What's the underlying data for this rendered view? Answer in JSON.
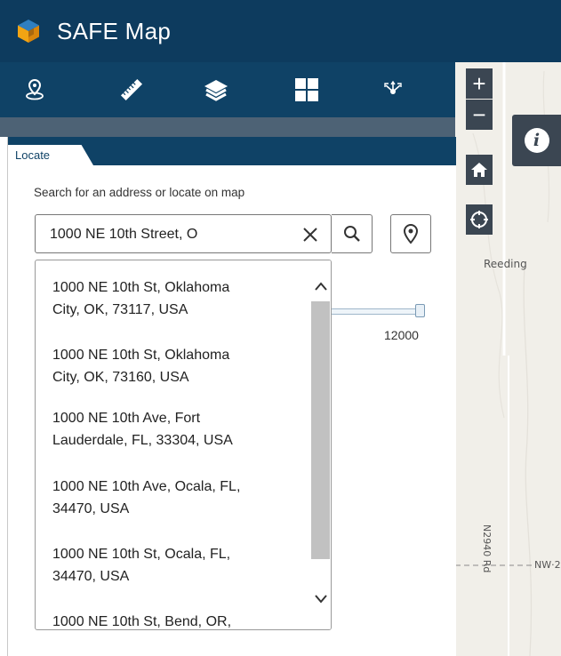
{
  "header": {
    "title": "SAFE Map",
    "logo": "cube-logo"
  },
  "toolbar": {
    "tools": [
      "locate-pin-icon",
      "ruler-icon",
      "layers-icon",
      "grid-icon",
      "share-icon"
    ]
  },
  "panel": {
    "tab_label": "Locate",
    "hint": "Search for an address or locate on map",
    "search": {
      "value": "1000 NE 10th Street, O",
      "placeholder": ""
    },
    "slider_max": "12000",
    "suggestions": [
      [
        "1000 NE 10th St, Oklahoma",
        "City, OK, 73117, USA"
      ],
      [
        "1000 NE 10th St, Oklahoma",
        "City, OK, 73160, USA"
      ],
      [
        "1000 NE 10th Ave, Fort",
        "Lauderdale, FL, 33304, USA"
      ],
      [
        "1000 NE 10th Ave, Ocala, FL,",
        "34470, USA"
      ],
      [
        "1000 NE 10th St, Ocala, FL,",
        "34470, USA"
      ],
      [
        "1000 NE 10th St, Bend, OR,",
        ""
      ]
    ]
  },
  "map": {
    "zoom_in": "+",
    "zoom_out": "−",
    "info": "i",
    "labels": {
      "town": "Reeding",
      "road": "N2940 Rd",
      "road2": "NW·2"
    }
  },
  "colors": {
    "header": "#0d3b5e",
    "toolbar": "#0f4266",
    "accent": "#0f4266"
  }
}
